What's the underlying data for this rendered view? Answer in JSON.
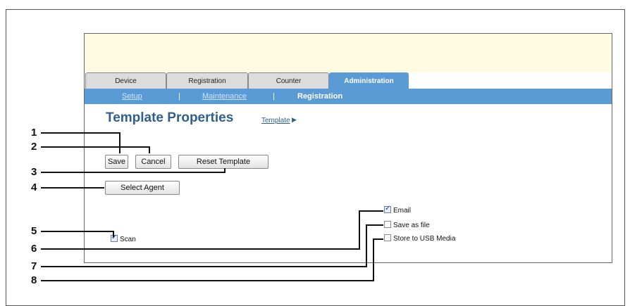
{
  "tabs": [
    {
      "label": "Device",
      "active": false
    },
    {
      "label": "Registration",
      "active": false
    },
    {
      "label": "Counter",
      "active": false
    },
    {
      "label": "Administration",
      "active": true
    }
  ],
  "subnav": {
    "setup": "Setup",
    "sep1": "|",
    "maintenance": "Maintenance",
    "sep2": "|",
    "registration": "Registration"
  },
  "page": {
    "title": "Template Properties",
    "template_link": "Template",
    "template_arrow": "▶"
  },
  "buttons": {
    "save": "Save",
    "cancel": "Cancel",
    "reset_template": "Reset Template",
    "select_agent": "Select Agent"
  },
  "checkboxes": {
    "scan": {
      "label": "Scan",
      "checked": true
    },
    "email": {
      "label": "Email",
      "checked": true
    },
    "save_as_file": {
      "label": "Save as file",
      "checked": false
    },
    "store_usb": {
      "label": "Store to USB Media",
      "checked": false
    }
  },
  "callouts": [
    "1",
    "2",
    "3",
    "4",
    "5",
    "6",
    "7",
    "8"
  ],
  "colors": {
    "accent": "#5b9bd5",
    "banner": "#fdfbe0",
    "title": "#2f5f8f"
  }
}
